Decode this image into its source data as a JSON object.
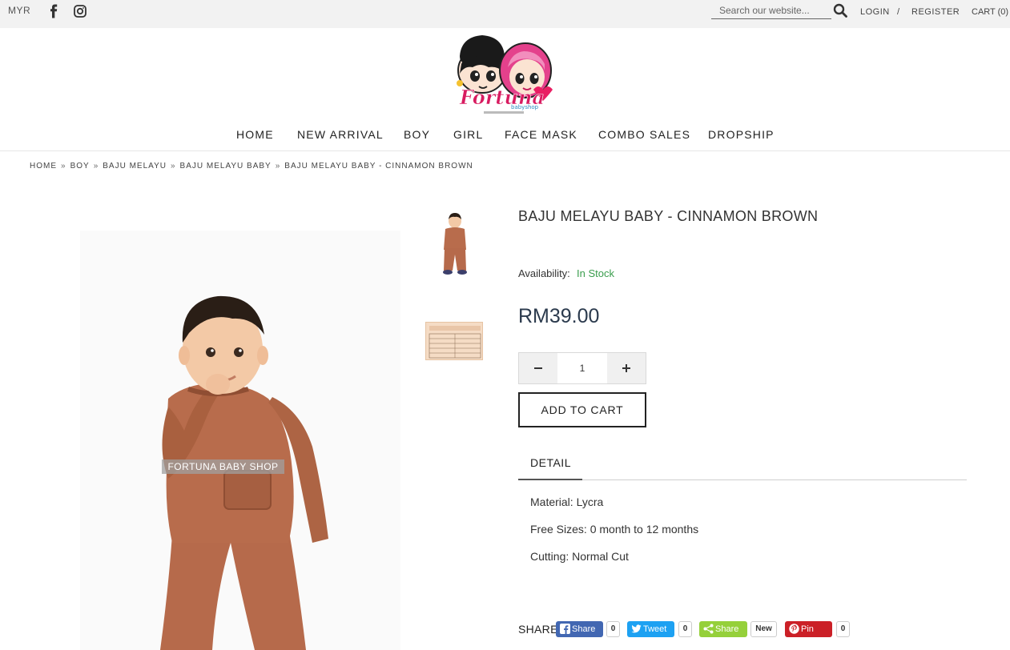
{
  "topbar": {
    "currency": "MYR",
    "search_placeholder": "Search our website...",
    "login": "LOGIN",
    "separator": "/",
    "register": "REGISTER",
    "cart": "CART (0)"
  },
  "nav": {
    "items": [
      "HOME",
      "NEW ARRIVAL",
      "BOY",
      "GIRL",
      "FACE MASK",
      "COMBO SALES",
      "DROPSHIP"
    ]
  },
  "breadcrumb": [
    "HOME",
    "BOY",
    "BAJU MELAYU",
    "BAJU MELAYU BABY",
    "BAJU MELAYU BABY - CINNAMON BROWN"
  ],
  "breadcrumb_separator": "»",
  "image": {
    "watermark": "FORTUNA BABY SHOP"
  },
  "product": {
    "title": "BAJU MELAYU BABY - CINNAMON BROWN",
    "availability_label": "Availability:",
    "availability_value": "In Stock",
    "price": "RM39.00",
    "quantity": "1",
    "add_to_cart": "ADD TO CART",
    "tab_detail": "DETAIL",
    "details": [
      "Material: Lycra",
      "Free Sizes: 0 month to 12 months",
      "Cutting: Normal Cut"
    ]
  },
  "share": {
    "label": "SHARE",
    "buttons": [
      {
        "label": "Share",
        "count": "0",
        "color": "#4267b2"
      },
      {
        "label": "Tweet",
        "count": "0",
        "color": "#1da1f2"
      },
      {
        "label": "Share",
        "count": "New",
        "color": "#95d03a"
      },
      {
        "label": "Pin",
        "count": "0",
        "color": "#cb2027"
      }
    ]
  },
  "colors": {
    "in_stock": "#3a9d4d",
    "price": "#2b3a4d",
    "product_brown": "#b5694a"
  },
  "icons": [
    "facebook-icon",
    "instagram-icon",
    "search-icon",
    "minus-icon",
    "plus-icon"
  ]
}
